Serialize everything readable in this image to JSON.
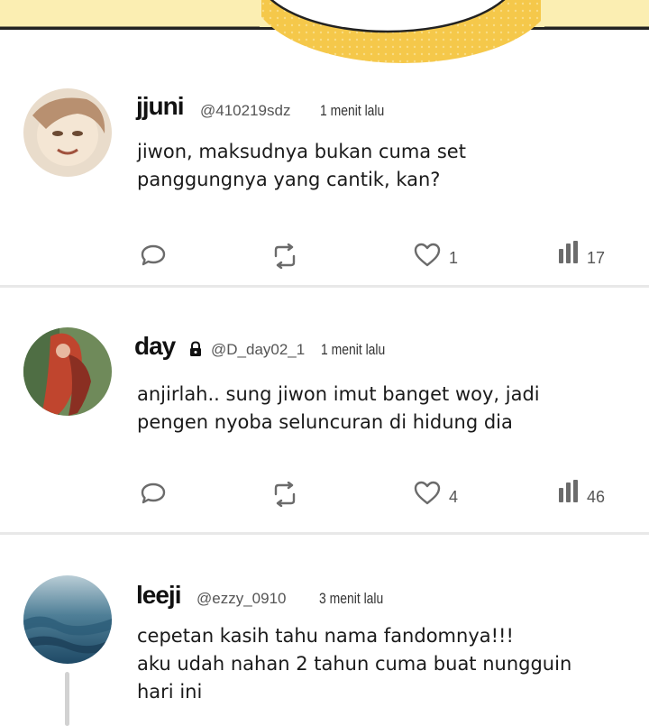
{
  "posts": [
    {
      "name": "jjuni",
      "handle": "@410219sdz",
      "time": "1 menit lalu",
      "text": "jiwon, maksudnya bukan cuma set\npanggungnya yang cantik, kan?",
      "likes": "1",
      "views": "17",
      "locked": false
    },
    {
      "name": "day",
      "handle": "@D_day02_1",
      "time": "1 menit lalu",
      "text": "anjirlah.. sung jiwon imut banget woy, jadi\npengen nyoba seluncuran di hidung dia",
      "likes": "4",
      "views": "46",
      "locked": true
    },
    {
      "name": "leeji",
      "handle": "@ezzy_0910",
      "time": "3 menit lalu",
      "text": "cepetan kasih tahu nama fandomnya!!!\naku udah nahan 2 tahun cuma buat nungguin\nhari ini",
      "locked": false
    }
  ],
  "colors": {
    "header_bg": "#fbeeb2",
    "bubble_yellow": "#f5c84a",
    "icon_gray": "#6b6b6b",
    "separator": "#e8e8e8"
  },
  "icons": [
    "reply-icon",
    "repost-icon",
    "heart-icon",
    "views-icon",
    "lock-icon"
  ]
}
